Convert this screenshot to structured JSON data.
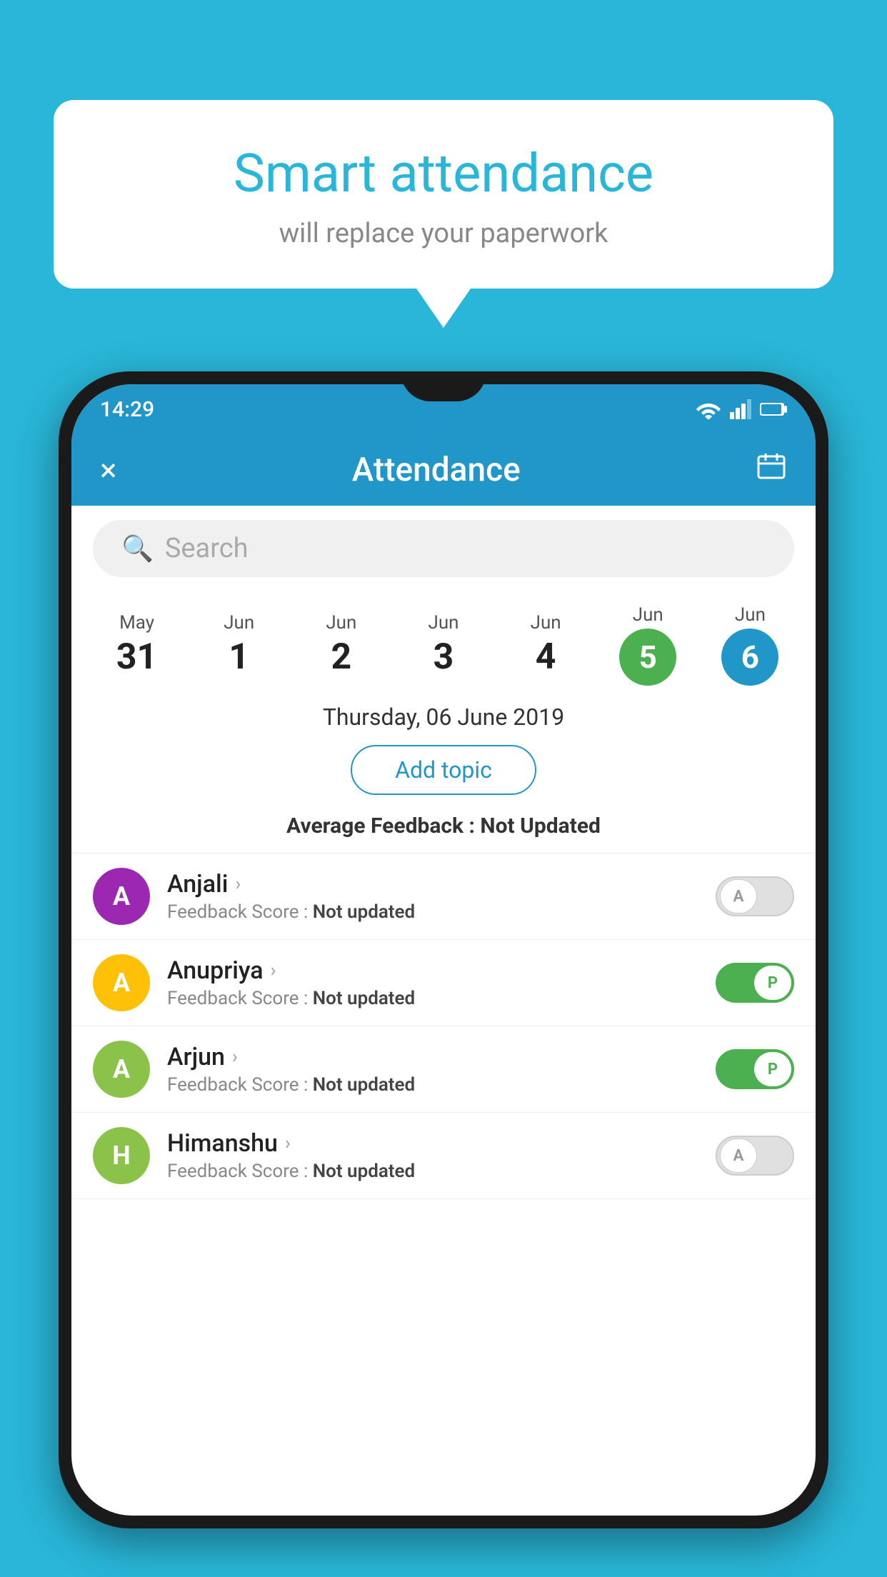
{
  "background_color": "#29B6D8",
  "bubble": {
    "title": "Smart attendance",
    "subtitle": "will replace your paperwork"
  },
  "status_bar": {
    "time": "14:29",
    "icons": [
      "wifi",
      "signal",
      "battery"
    ]
  },
  "app_bar": {
    "title": "Attendance",
    "close_label": "×",
    "calendar_label": "📅"
  },
  "search": {
    "placeholder": "Search"
  },
  "dates": [
    {
      "month": "May",
      "day": "31",
      "state": "normal"
    },
    {
      "month": "Jun",
      "day": "1",
      "state": "normal"
    },
    {
      "month": "Jun",
      "day": "2",
      "state": "normal"
    },
    {
      "month": "Jun",
      "day": "3",
      "state": "normal"
    },
    {
      "month": "Jun",
      "day": "4",
      "state": "normal"
    },
    {
      "month": "Jun",
      "day": "5",
      "state": "today"
    },
    {
      "month": "Jun",
      "day": "6",
      "state": "selected"
    }
  ],
  "selected_date_label": "Thursday, 06 June 2019",
  "add_topic_label": "Add topic",
  "avg_feedback": {
    "label": "Average Feedback : ",
    "value": "Not Updated"
  },
  "students": [
    {
      "name": "Anjali",
      "avatar_letter": "A",
      "avatar_color": "#9C27B0",
      "feedback_label": "Feedback Score : ",
      "feedback_value": "Not updated",
      "attendance": "absent",
      "toggle_label": "A"
    },
    {
      "name": "Anupriya",
      "avatar_letter": "A",
      "avatar_color": "#FFC107",
      "feedback_label": "Feedback Score : ",
      "feedback_value": "Not updated",
      "attendance": "present",
      "toggle_label": "P"
    },
    {
      "name": "Arjun",
      "avatar_letter": "A",
      "avatar_color": "#8BC34A",
      "feedback_label": "Feedback Score : ",
      "feedback_value": "Not updated",
      "attendance": "present",
      "toggle_label": "P"
    },
    {
      "name": "Himanshu",
      "avatar_letter": "H",
      "avatar_color": "#8BC34A",
      "feedback_label": "Feedback Score : ",
      "feedback_value": "Not updated",
      "attendance": "absent",
      "toggle_label": "A"
    }
  ]
}
